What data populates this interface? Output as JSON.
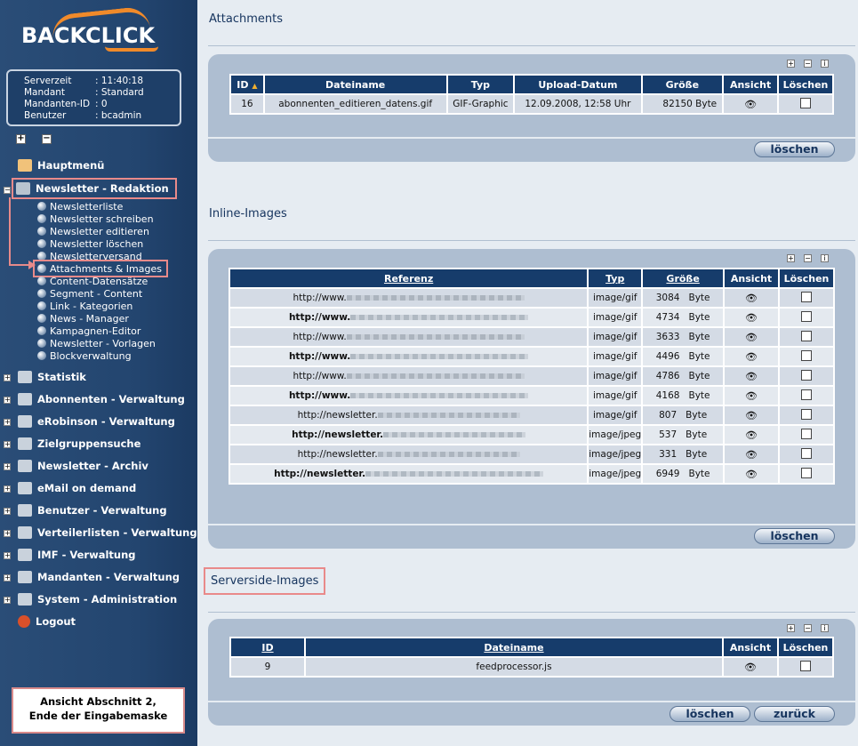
{
  "sidebar": {
    "logo_text": "BACKCLICK",
    "info": [
      {
        "key": "Serverzeit",
        "value": ": 11:40:18"
      },
      {
        "key": "Mandant",
        "value": ": Standard"
      },
      {
        "key": "Mandanten-ID",
        "value": ": 0"
      },
      {
        "key": "Benutzer",
        "value": ": bcadmin"
      }
    ],
    "hauptmenue": "Hauptmenü",
    "redaktion": "Newsletter - Redaktion",
    "sub_items": [
      "Newsletterliste",
      "Newsletter schreiben",
      "Newsletter editieren",
      "Newsletter löschen",
      "Newsletterversand",
      "Attachments & Images",
      "Content-Datensätze",
      "Segment - Content",
      "Link - Kategorien",
      "News - Manager",
      "Kampagnen-Editor",
      "Newsletter - Vorlagen",
      "Blockverwaltung"
    ],
    "sections": [
      "Statistik",
      "Abonnenten - Verwaltung",
      "eRobinson - Verwaltung",
      "Zielgruppensuche",
      "Newsletter - Archiv",
      "eMail on demand",
      "Benutzer - Verwaltung",
      "Verteilerlisten - Verwaltung",
      "IMF - Verwaltung",
      "Mandanten - Verwaltung",
      "System - Administration"
    ],
    "logout": "Logout",
    "note_line1": "Ansicht Abschnitt 2,",
    "note_line2": "Ende der Eingabemaske"
  },
  "attachments": {
    "title": "Attachments",
    "headers": [
      "ID",
      "Dateiname",
      "Typ",
      "Upload-Datum",
      "Größe",
      "Ansicht",
      "Löschen"
    ],
    "rows": [
      {
        "id": "16",
        "name": "abonnenten_editieren_datens.gif",
        "type": "GIF-Graphic",
        "date": "12.09.2008, 12:58 Uhr",
        "size": "82150 Byte"
      }
    ],
    "button": "löschen"
  },
  "inline": {
    "title": "Inline-Images",
    "headers": [
      "Referenz",
      "Typ",
      "Größe",
      "Ansicht",
      "Löschen"
    ],
    "rows": [
      {
        "ref": "http://www.",
        "type": "image/gif",
        "size": "3084",
        "unit": "Byte"
      },
      {
        "ref": "http://www.",
        "type": "image/gif",
        "size": "4734",
        "unit": "Byte"
      },
      {
        "ref": "http://www.",
        "type": "image/gif",
        "size": "3633",
        "unit": "Byte"
      },
      {
        "ref": "http://www.",
        "type": "image/gif",
        "size": "4496",
        "unit": "Byte"
      },
      {
        "ref": "http://www.",
        "type": "image/gif",
        "size": "4786",
        "unit": "Byte"
      },
      {
        "ref": "http://www.",
        "type": "image/gif",
        "size": "4168",
        "unit": "Byte"
      },
      {
        "ref": "http://newsletter.",
        "type": "image/gif",
        "size": "807",
        "unit": "Byte"
      },
      {
        "ref": "http://newsletter.",
        "type": "image/jpeg",
        "size": "537",
        "unit": "Byte"
      },
      {
        "ref": "http://newsletter.",
        "type": "image/jpeg",
        "size": "331",
        "unit": "Byte"
      },
      {
        "ref": "http://newsletter.",
        "type": "image/jpeg",
        "size": "6949",
        "unit": "Byte"
      }
    ],
    "button": "löschen"
  },
  "serverside": {
    "title": "Serverside-Images",
    "headers": [
      "ID",
      "Dateiname",
      "Ansicht",
      "Löschen"
    ],
    "rows": [
      {
        "id": "9",
        "name": "feedprocessor.js"
      }
    ],
    "button_delete": "löschen",
    "button_back": "zurück"
  }
}
